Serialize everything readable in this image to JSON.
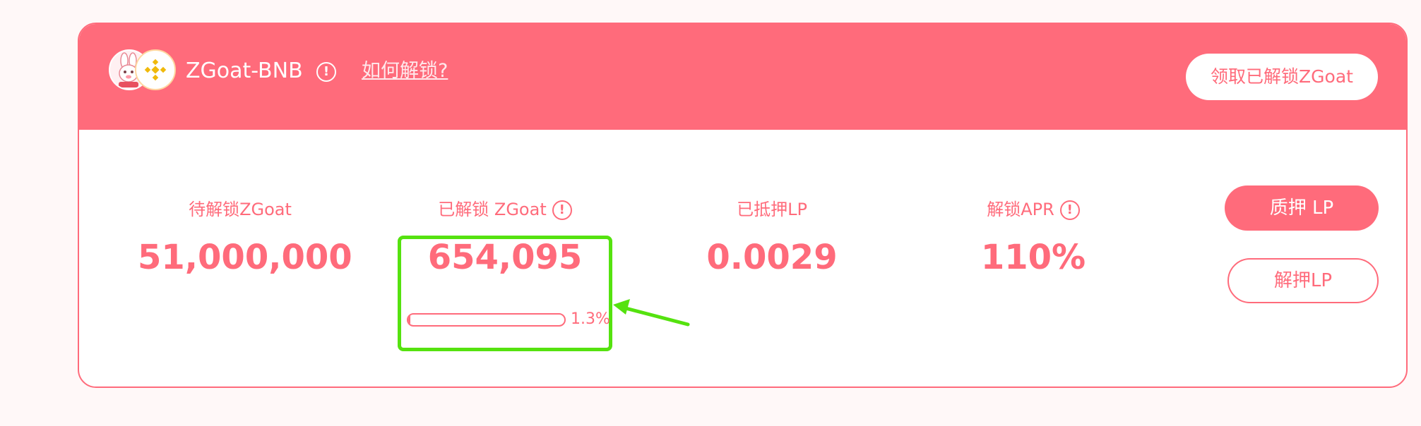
{
  "header": {
    "pair_name": "ZGoat-BNB",
    "info_glyph": "!",
    "how_to_unlock_link": "如何解锁?",
    "claim_button_label": "领取已解锁ZGoat",
    "logos": [
      "zgoat-mascot-logo",
      "bnb-logo"
    ]
  },
  "stats": [
    {
      "label": "待解锁ZGoat",
      "value": "51,000,000",
      "has_info": false
    },
    {
      "label": "已解锁 ZGoat",
      "value": "654,095",
      "has_info": true
    },
    {
      "label": "已抵押LP",
      "value": "0.0029",
      "has_info": false
    },
    {
      "label": "解锁APR",
      "value": "110%",
      "has_info": true
    }
  ],
  "progress": {
    "percent_text": "1.3%",
    "fraction": 0.013
  },
  "actions": {
    "stake_label": "质押 LP",
    "unstake_label": "解押LP"
  },
  "colors": {
    "brand": "#ff6b7b",
    "highlight": "#55e20f",
    "background": "#fff8f8",
    "bnb_gold": "#f0b90b"
  }
}
